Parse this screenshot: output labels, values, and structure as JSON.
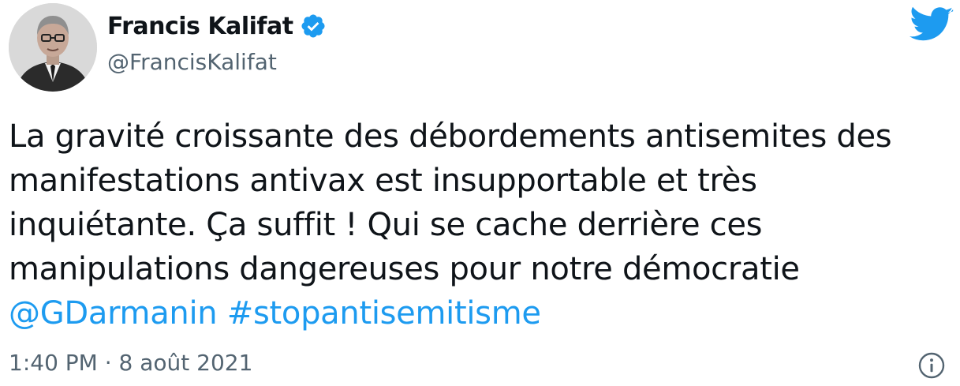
{
  "author": {
    "name": "Francis Kalifat",
    "handle": "@FrancisKalifat",
    "verified": true
  },
  "tweet": {
    "line1": "La gravité croissante des débordements antisemites des",
    "line2": "manifestations antivax est insupportable et très",
    "line3": "inquiétante. Ça suffit ! Qui  se cache derrière ces",
    "line4": "manipulations dangereuses pour notre démocratie",
    "mention": "@GDarmanin",
    "hashtag": "#stopantisemitisme"
  },
  "meta": {
    "timestamp": "1:40 PM · 8 août 2021"
  },
  "icons": {
    "brand": "twitter-bird-icon",
    "verified": "verified-badge-icon",
    "info": "info-icon"
  },
  "colors": {
    "accent": "#1d9bf0",
    "text": "#0f1419",
    "secondary": "#536471"
  }
}
